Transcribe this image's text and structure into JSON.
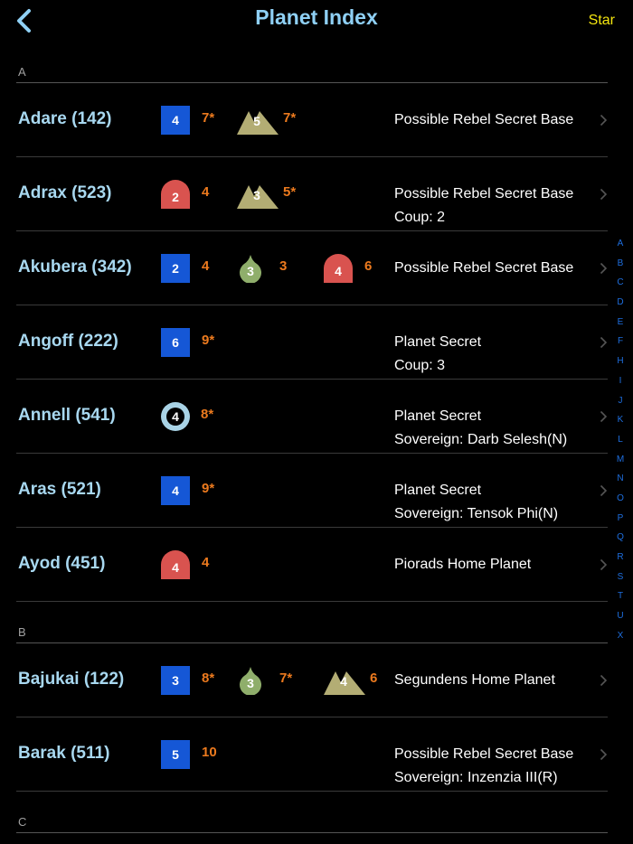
{
  "nav": {
    "title": "Planet Index",
    "right_label": "Star"
  },
  "sections": [
    {
      "letter": "A",
      "rows": [
        {
          "name": "Adare (142)",
          "units": [
            {
              "shape": "square",
              "n": "4",
              "v": "7*"
            },
            {
              "shape": "mountain",
              "n": "5",
              "v": "7*"
            }
          ],
          "line1": "Possible Rebel Secret Base",
          "line2": ""
        },
        {
          "name": "Adrax (523)",
          "units": [
            {
              "shape": "dome",
              "n": "2",
              "v": "4"
            },
            {
              "shape": "mountain",
              "n": "3",
              "v": "5*"
            }
          ],
          "line1": "Possible Rebel Secret Base",
          "line2": "Coup: 2"
        },
        {
          "name": "Akubera (342)",
          "units": [
            {
              "shape": "square",
              "n": "2",
              "v": "4"
            },
            {
              "shape": "drop",
              "n": "3",
              "v": "3"
            },
            {
              "shape": "dome",
              "n": "4",
              "v": "6"
            }
          ],
          "line1": "Possible Rebel Secret Base",
          "line2": ""
        },
        {
          "name": "Angoff (222)",
          "units": [
            {
              "shape": "square",
              "n": "6",
              "v": "9*"
            }
          ],
          "line1": "Planet Secret",
          "line2": "Coup: 3"
        },
        {
          "name": "Annell (541)",
          "units": [
            {
              "shape": "circle",
              "n": "4",
              "v": "8*"
            }
          ],
          "line1": "Planet Secret",
          "line2": "Sovereign: Darb Selesh(N)"
        },
        {
          "name": "Aras (521)",
          "units": [
            {
              "shape": "square",
              "n": "4",
              "v": "9*"
            }
          ],
          "line1": "Planet Secret",
          "line2": "Sovereign: Tensok Phi(N)"
        },
        {
          "name": "Ayod (451)",
          "units": [
            {
              "shape": "dome",
              "n": "4",
              "v": "4"
            }
          ],
          "line1": "Piorads Home Planet",
          "line2": ""
        }
      ]
    },
    {
      "letter": "B",
      "rows": [
        {
          "name": "Bajukai (122)",
          "units": [
            {
              "shape": "square",
              "n": "3",
              "v": "8*"
            },
            {
              "shape": "drop",
              "n": "3",
              "v": "7*"
            },
            {
              "shape": "mountain",
              "n": "4",
              "v": "6"
            }
          ],
          "line1": "Segundens Home Planet",
          "line2": ""
        },
        {
          "name": "Barak (511)",
          "units": [
            {
              "shape": "square",
              "n": "5",
              "v": "10"
            }
          ],
          "line1": "Possible Rebel Secret Base",
          "line2": "Sovereign: Inzenzia III(R)"
        }
      ]
    },
    {
      "letter": "C",
      "rows": []
    }
  ],
  "index_letters": [
    "A",
    "B",
    "C",
    "D",
    "E",
    "F",
    "H",
    "I",
    "J",
    "K",
    "L",
    "M",
    "N",
    "O",
    "P",
    "Q",
    "R",
    "S",
    "T",
    "U",
    "X"
  ],
  "colors": {
    "square": "#1557d6",
    "dome": "#d9534f",
    "mountain": "#b3ad74",
    "drop": "#8fae6b",
    "circle": "#a9d3e6",
    "value": "#ec7a1e",
    "title": "#8fd0f5",
    "star": "#f5e60f",
    "index": "#1e6fe0"
  }
}
